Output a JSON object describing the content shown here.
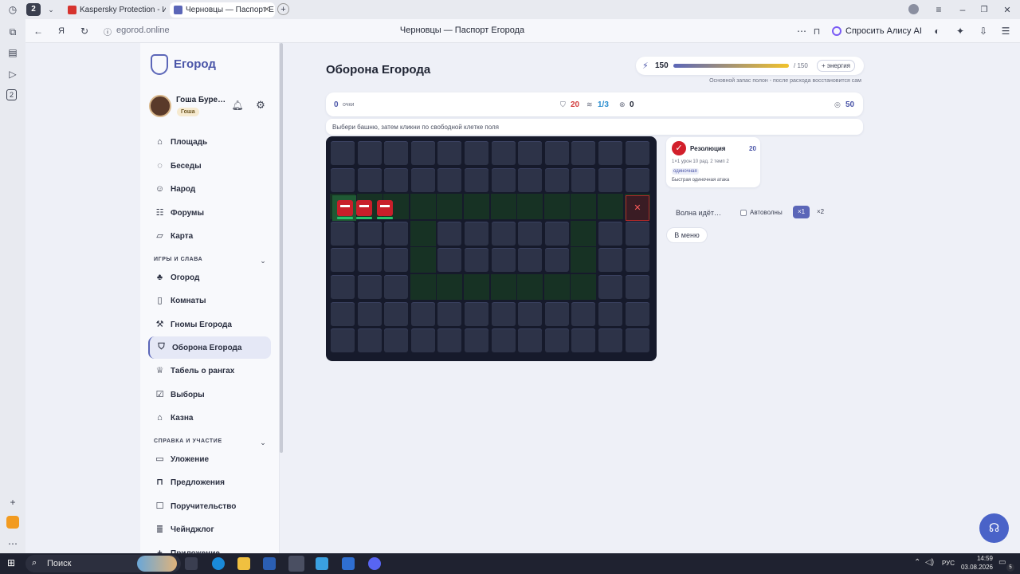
{
  "browser": {
    "tab_count": "2",
    "tabs": [
      {
        "title": "Kaspersky Protection - Ин"
      },
      {
        "title": "Черновцы — Паспорт Е"
      }
    ],
    "address": "egorod.online",
    "page_title": "Черновцы — Паспорт Егорода",
    "alice_label": "Спросить Алису AI"
  },
  "sidebar": {
    "logo_text": "Егород",
    "user_name": "Гоша Буре…",
    "user_badge": "Гоша",
    "nav_main": [
      {
        "label": "Площадь",
        "icon": "home-icon"
      },
      {
        "label": "Беседы",
        "icon": "chat-icon"
      },
      {
        "label": "Народ",
        "icon": "people-icon"
      },
      {
        "label": "Форумы",
        "icon": "forum-icon"
      },
      {
        "label": "Карта",
        "icon": "map-icon"
      }
    ],
    "section_games": "Игры и слава",
    "nav_games": [
      {
        "label": "Огород",
        "icon": "sprout-icon"
      },
      {
        "label": "Комнаты",
        "icon": "door-icon"
      },
      {
        "label": "Гномы Егорода",
        "icon": "axe-icon"
      },
      {
        "label": "Оборона Егорода",
        "icon": "shield-icon"
      },
      {
        "label": "Табель о рангах",
        "icon": "trophy-icon"
      },
      {
        "label": "Выборы",
        "icon": "ballot-icon"
      },
      {
        "label": "Казна",
        "icon": "bank-icon"
      }
    ],
    "section_help": "Справка и участие",
    "nav_help": [
      {
        "label": "Уложение",
        "icon": "book-icon"
      },
      {
        "label": "Предложения",
        "icon": "bookmark-icon"
      },
      {
        "label": "Поручительство",
        "icon": "handshake-icon"
      },
      {
        "label": "Чейнджлог",
        "icon": "changelog-icon"
      },
      {
        "label": "Приложение",
        "icon": "plus-icon"
      }
    ]
  },
  "energy": {
    "current": "150",
    "max": "/ 150",
    "fill_fraction": 1.0,
    "button": "+ энергия",
    "note": "Основной запас полон - после расхода восстановится сам"
  },
  "game": {
    "title": "Оборона Егорода",
    "score": "0",
    "score_label": "очки",
    "lives": "20",
    "wave": "1/3",
    "kills": "0",
    "coins": "50",
    "hint": "Выбери башню, затем кликни по свободной клетке поля",
    "tower": {
      "name": "Резолюция",
      "cost": "20",
      "stats": "1×1 урон 10 рад. 2 темп 2",
      "tag": "одиночная",
      "desc": "Быстрая одиночная атака"
    },
    "wave_status": "Волна идёт…",
    "autowave_label": "Автоволны",
    "speed_1": "×1",
    "speed_2": "×2",
    "menu_button": "В меню"
  },
  "taskbar": {
    "search": "Поиск",
    "lang": "РУС",
    "time": "14:59",
    "date": "03.08.2026",
    "notif_count": "5"
  }
}
